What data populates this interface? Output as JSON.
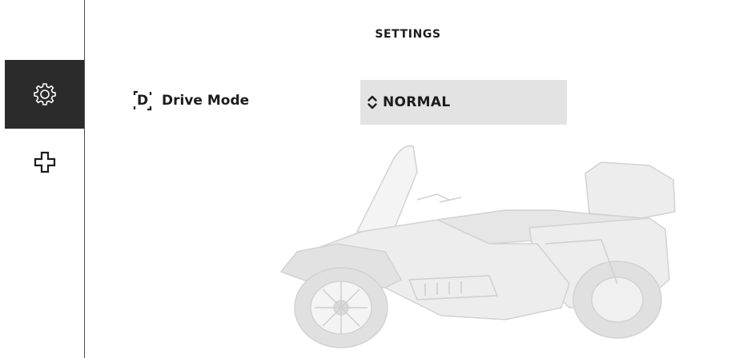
{
  "sidebar": {
    "items": [
      {
        "name": "settings",
        "icon": "gear-icon",
        "active": true
      },
      {
        "name": "medical",
        "icon": "cross-icon",
        "active": false
      }
    ]
  },
  "header": {
    "title": "SETTINGS"
  },
  "drive_mode": {
    "glyph": "D",
    "label": "Drive Mode",
    "value": "NORMAL"
  },
  "colors": {
    "active_nav_bg": "#2b2b2b",
    "select_bg": "#e3e3e3",
    "text": "#1c1c1c",
    "divider": "#4a4a4a"
  }
}
